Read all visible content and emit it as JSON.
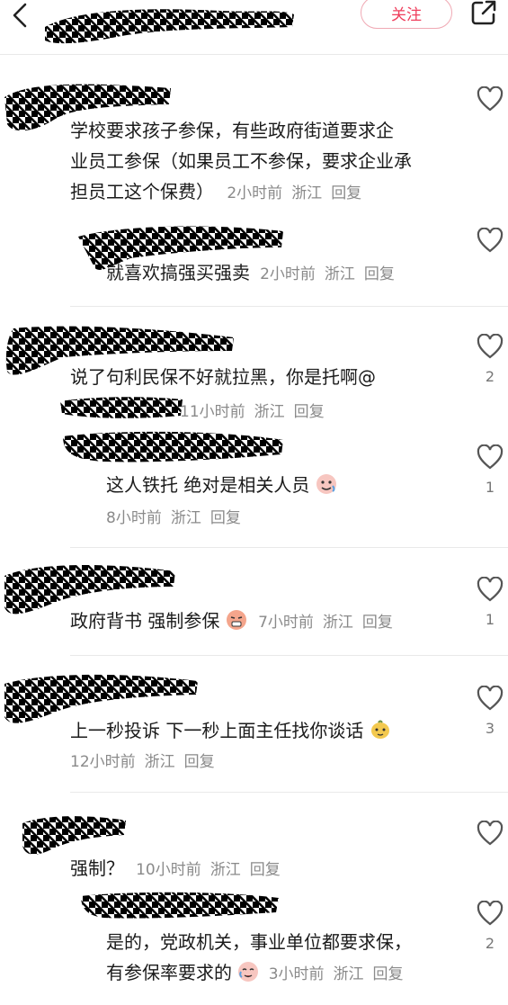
{
  "header": {
    "follow_label": "关注"
  },
  "comments": [
    {
      "text_line1": "学校要求孩子参保，有些政府街道要求企",
      "text_line2": "业员工参保（如果员工不参保，要求企业承",
      "text_line3": "担员工这个保费）",
      "time": "2小时前",
      "location": "浙江",
      "reply": "回复",
      "likes": "",
      "replies": [
        {
          "text": "就喜欢搞强买强卖",
          "time": "2小时前",
          "location": "浙江",
          "reply": "回复",
          "likes": ""
        }
      ]
    },
    {
      "text_line1": "说了句利民保不好就拉黑，你是托啊@",
      "time": "11小时前",
      "location": "浙江",
      "reply": "回复",
      "likes": "2",
      "replies": [
        {
          "text": "这人铁托 绝对是相关人员",
          "time": "8小时前",
          "location": "浙江",
          "reply": "回复",
          "likes": "1"
        }
      ]
    },
    {
      "text_line1": "政府背书 强制参保",
      "time": "7小时前",
      "location": "浙江",
      "reply": "回复",
      "likes": "1"
    },
    {
      "text_line1": "上一秒投诉 下一秒上面主任找你谈话",
      "time": "12小时前",
      "location": "浙江",
      "reply": "回复",
      "likes": "3"
    },
    {
      "text_line1": "强制？",
      "time": "10小时前",
      "location": "浙江",
      "reply": "回复",
      "likes": "",
      "replies": [
        {
          "text_line1": "是的，党政机关，事业单位都要求保，",
          "text_line2": "有参保率要求的",
          "time": "3小时前",
          "location": "浙江",
          "reply": "回复",
          "likes": "2"
        }
      ]
    }
  ],
  "colors": {
    "accent": "#ef3e5c",
    "meta": "#8a8a8a"
  },
  "icons": [
    "back-arrow-icon",
    "share-icon",
    "heart-icon",
    "emoji-icon"
  ]
}
